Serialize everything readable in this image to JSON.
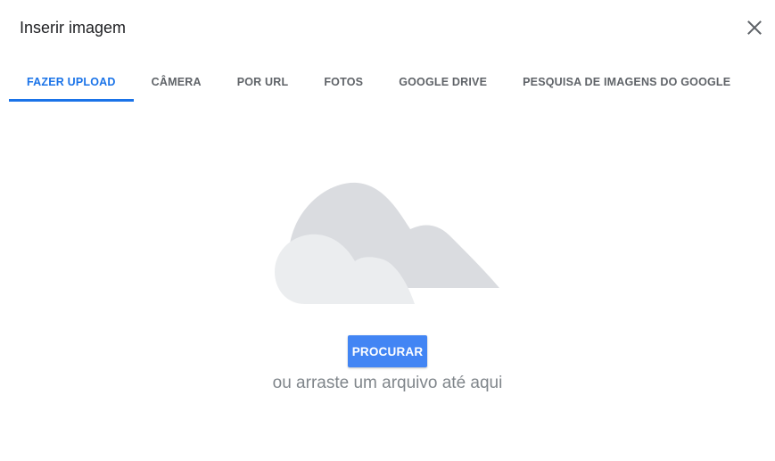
{
  "dialog": {
    "title": "Inserir imagem",
    "close_icon": "close-icon"
  },
  "tabs": [
    {
      "label": "FAZER UPLOAD",
      "active": true
    },
    {
      "label": "CÂMERA",
      "active": false
    },
    {
      "label": "POR URL",
      "active": false
    },
    {
      "label": "FOTOS",
      "active": false
    },
    {
      "label": "GOOGLE DRIVE",
      "active": false
    },
    {
      "label": "PESQUISA DE IMAGENS DO GOOGLE",
      "active": false
    }
  ],
  "upload": {
    "illustration_icon": "cloud-icon",
    "browse_label": "PROCURAR",
    "drag_hint": "ou arraste um arquivo até aqui"
  },
  "colors": {
    "accent": "#1a73e8",
    "button": "#4285f4",
    "tab_text": "#5f6368",
    "hint_text": "#80868b",
    "cloud_back": "#dadce0",
    "cloud_front": "#ebedef"
  }
}
